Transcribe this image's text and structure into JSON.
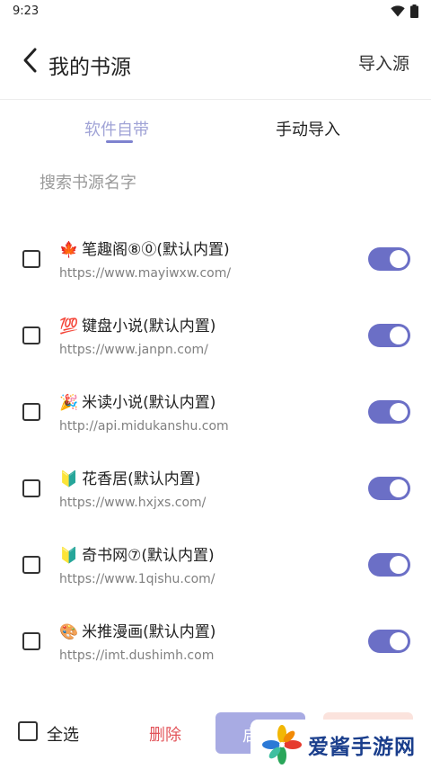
{
  "status_bar": {
    "time": "9:23",
    "wifi_icon": "wifi-icon",
    "battery_icon": "battery-icon"
  },
  "header": {
    "title": "我的书源",
    "import_label": "导入源",
    "back_icon": "chevron-left-icon"
  },
  "tabs": [
    {
      "label": "软件自带",
      "active": true
    },
    {
      "label": "手动导入",
      "active": false
    }
  ],
  "search": {
    "placeholder": "搜索书源名字",
    "value": ""
  },
  "sources": [
    {
      "emoji": "🍁",
      "name": "笔趣阁⑧⓪(默认内置)",
      "url": "https://www.mayiwxw.com/",
      "checked": false,
      "enabled": true
    },
    {
      "emoji": "💯",
      "name": "键盘小说(默认内置)",
      "url": "https://www.janpn.com/",
      "checked": false,
      "enabled": true
    },
    {
      "emoji": "🎉",
      "name": "米读小说(默认内置)",
      "url": "http://api.midukanshu.com",
      "checked": false,
      "enabled": true
    },
    {
      "emoji": "🔰",
      "name": "花香居(默认内置)",
      "url": "https://www.hxjxs.com/",
      "checked": false,
      "enabled": true
    },
    {
      "emoji": "🔰",
      "name": "奇书网⑦(默认内置)",
      "url": "https://www.1qishu.com/",
      "checked": false,
      "enabled": true
    },
    {
      "emoji": "🎨",
      "name": "米推漫画(默认内置)",
      "url": "https://imt.dushimh.com",
      "checked": false,
      "enabled": true
    }
  ],
  "bottom_bar": {
    "select_all_label": "全选",
    "delete_label": "删除",
    "enable_label": "启"
  },
  "watermark": {
    "text": "爱酱手游网"
  },
  "colors": {
    "accent": "#6b6fc6",
    "tab_active": "#a0a3d6",
    "delete": "#e2545a",
    "enable_button": "#a8abe3",
    "disable_button": "#fbe3dd"
  }
}
